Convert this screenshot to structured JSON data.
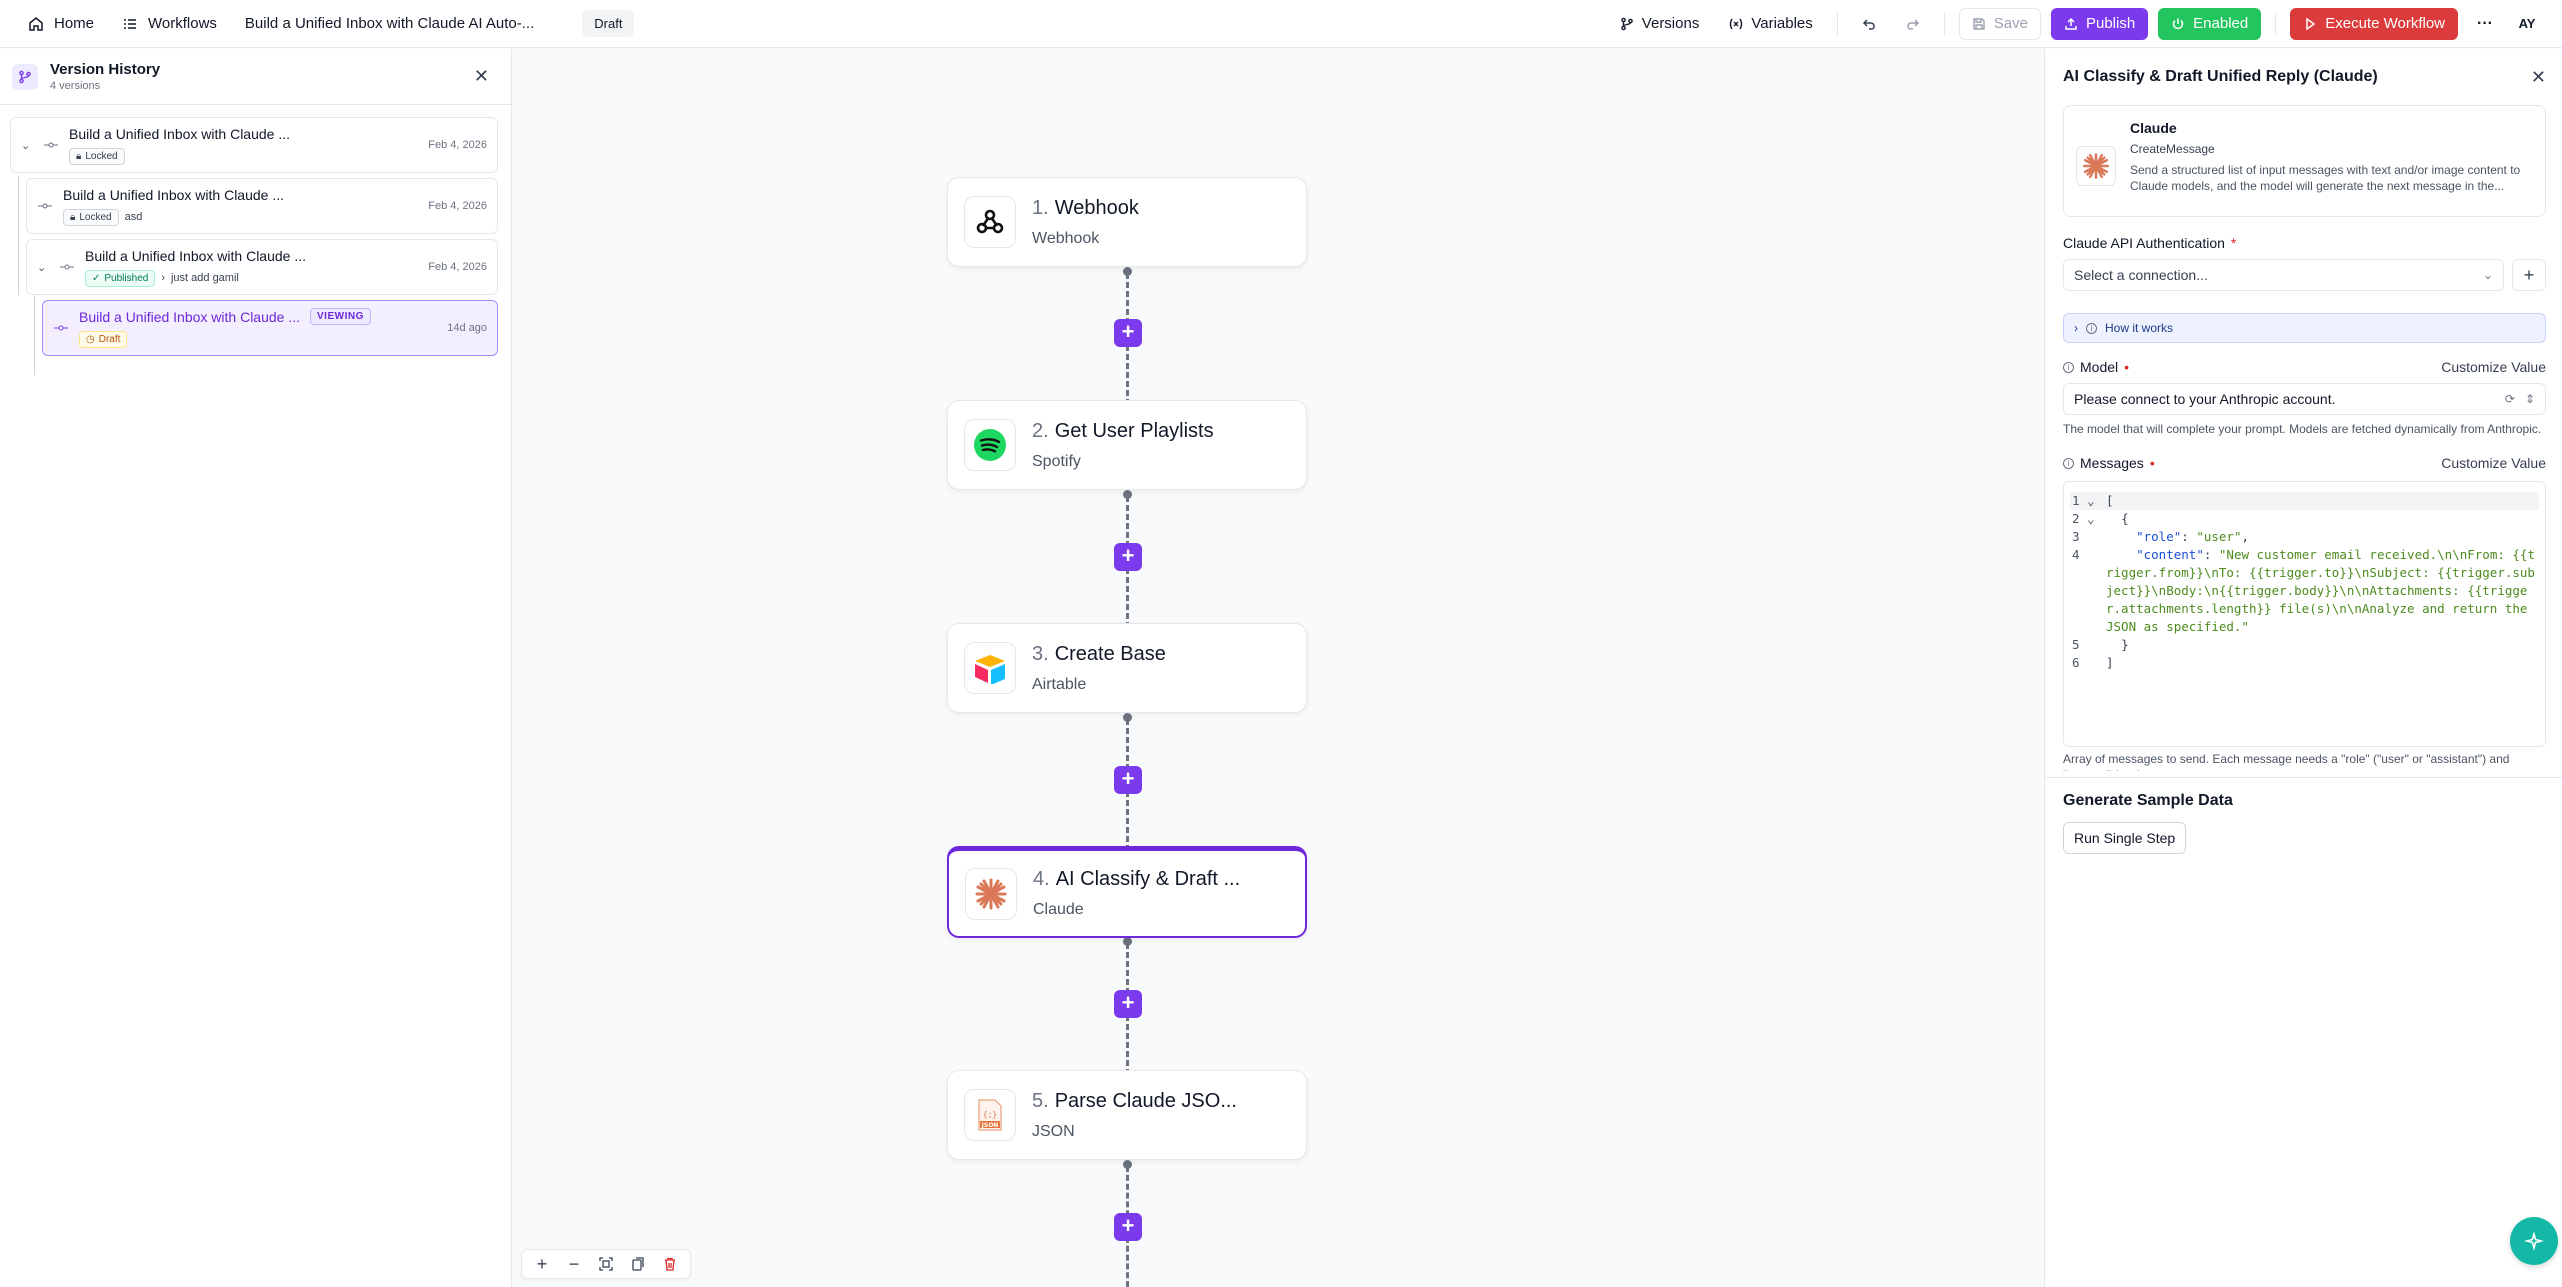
{
  "topbar": {
    "home": "Home",
    "workflows": "Workflows",
    "flow_name": "Build a Unified Inbox with Claude AI Auto-...",
    "status_pill": "Draft",
    "versions": "Versions",
    "variables": "Variables",
    "save": "Save",
    "publish": "Publish",
    "enabled": "Enabled",
    "execute": "Execute Workflow",
    "more": "···",
    "avatar": "AY"
  },
  "version_history": {
    "title": "Version History",
    "subtitle": "4 versions",
    "items": [
      {
        "name": "Build a Unified Inbox with Claude ...",
        "badge": "Locked",
        "note": "",
        "date": "Feb 4, 2026"
      },
      {
        "name": "Build a Unified Inbox with Claude ...",
        "badge": "Locked",
        "note": "asd",
        "date": "Feb 4, 2026"
      },
      {
        "name": "Build a Unified Inbox with Claude ...",
        "badge": "Published",
        "note": "just add gamil",
        "date": "Feb 4, 2026"
      },
      {
        "name": "Build a Unified Inbox with Claude ...",
        "badge": "Draft",
        "tag": "VIEWING",
        "note": "",
        "date": "14d ago"
      }
    ]
  },
  "canvas": {
    "steps": [
      {
        "num": "1.",
        "title": "Webhook",
        "app": "Webhook",
        "icon": "webhook-icon"
      },
      {
        "num": "2.",
        "title": "Get User Playlists",
        "app": "Spotify",
        "icon": "spotify-icon"
      },
      {
        "num": "3.",
        "title": "Create Base",
        "app": "Airtable",
        "icon": "airtable-icon"
      },
      {
        "num": "4.",
        "title": "AI Classify & Draft ...",
        "app": "Claude",
        "icon": "claude-icon"
      },
      {
        "num": "5.",
        "title": "Parse Claude JSO...",
        "app": "JSON",
        "icon": "json-icon"
      }
    ]
  },
  "config": {
    "title": "AI Classify & Draft Unified Reply (Claude)",
    "piece_name": "Claude",
    "piece_action": "CreateMessage",
    "piece_desc": "Send a structured list of input messages with text and/or image content to Claude models, and the model will generate the next message in the...",
    "auth_label": "Claude API Authentication",
    "auth_placeholder": "Select a connection...",
    "how_it_works": "How it works",
    "model_label": "Model",
    "customize": "Customize Value",
    "model_value": "Please connect to your Anthropic account.",
    "model_help": "The model that will complete your prompt. Models are fetched dynamically from Anthropic.",
    "messages_label": "Messages",
    "code": {
      "l1": "[",
      "l2": "  {",
      "l3_key": "\"role\"",
      "l3_val": "\"user\"",
      "l4_key": "\"content\"",
      "l4_val": "\"New customer email received.\\n\\nFrom: {{trigger.from}}\\nTo: {{trigger.to}}\\nSubject: {{trigger.subject}}\\nBody:\\n{{trigger.body}}\\n\\nAttachments: {{trigger.attachments.length}} file(s)\\n\\nAnalyze and return the JSON as specified.\"",
      "l5": "  }",
      "l6": "]"
    },
    "messages_help": "Array of messages to send. Each message needs a \"role\" (\"user\" or \"assistant\") and \"content\" (text).",
    "sample_title": "Generate Sample Data",
    "run_single": "Run Single Step"
  }
}
